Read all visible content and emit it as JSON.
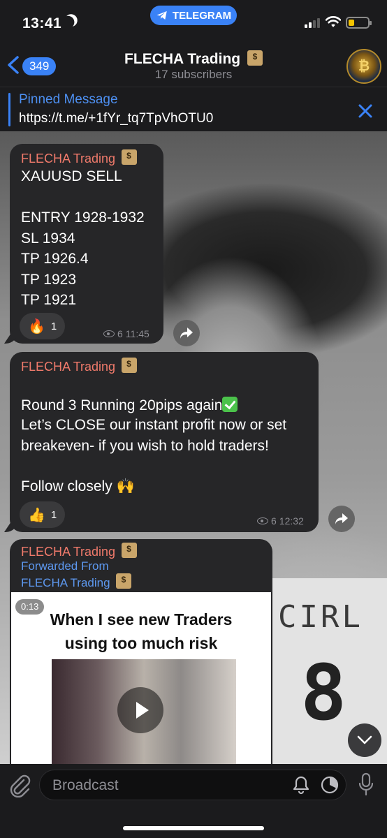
{
  "status_bar": {
    "time": "13:41",
    "app_pill": "TELEGRAM"
  },
  "header": {
    "back_count": "349",
    "title": "FLECHA Trading",
    "subtitle": "17 subscribers",
    "avatar_letter": "₿"
  },
  "pinned": {
    "title": "Pinned Message",
    "text": "https://t.me/+1fYr_tq7TpVhOTU0"
  },
  "messages": [
    {
      "author": "FLECHA Trading",
      "text": "XAUUSD SELL\n\nENTRY 1928-1932\nSL 1934\nTP 1926.4\nTP 1923\nTP 1921",
      "reaction": {
        "emoji": "🔥",
        "count": "1"
      },
      "views": "6",
      "time": "11:45"
    },
    {
      "author": "FLECHA Trading",
      "line1": "Round 3 Running 20pips again",
      "text": "Let’s CLOSE our instant profit now or set breakeven- if you wish to hold traders!",
      "line3": "Follow closely 🙌",
      "reaction": {
        "emoji": "👍",
        "count": "1"
      },
      "views": "6",
      "time": "12:32"
    },
    {
      "author": "FLECHA Trading",
      "forwarded_label": "Forwarded From",
      "forwarded_from": "FLECHA Trading",
      "video": {
        "duration": "0:13",
        "caption": "When I see new Traders using too much risk"
      }
    }
  ],
  "background_text": {
    "plate_text": "CIRL",
    "plate_number": "8"
  },
  "input": {
    "placeholder": "Broadcast"
  },
  "colors": {
    "accent": "#3a82f6",
    "author": "#f07a6b",
    "forward": "#5d98ef",
    "bubble": "#262628"
  }
}
